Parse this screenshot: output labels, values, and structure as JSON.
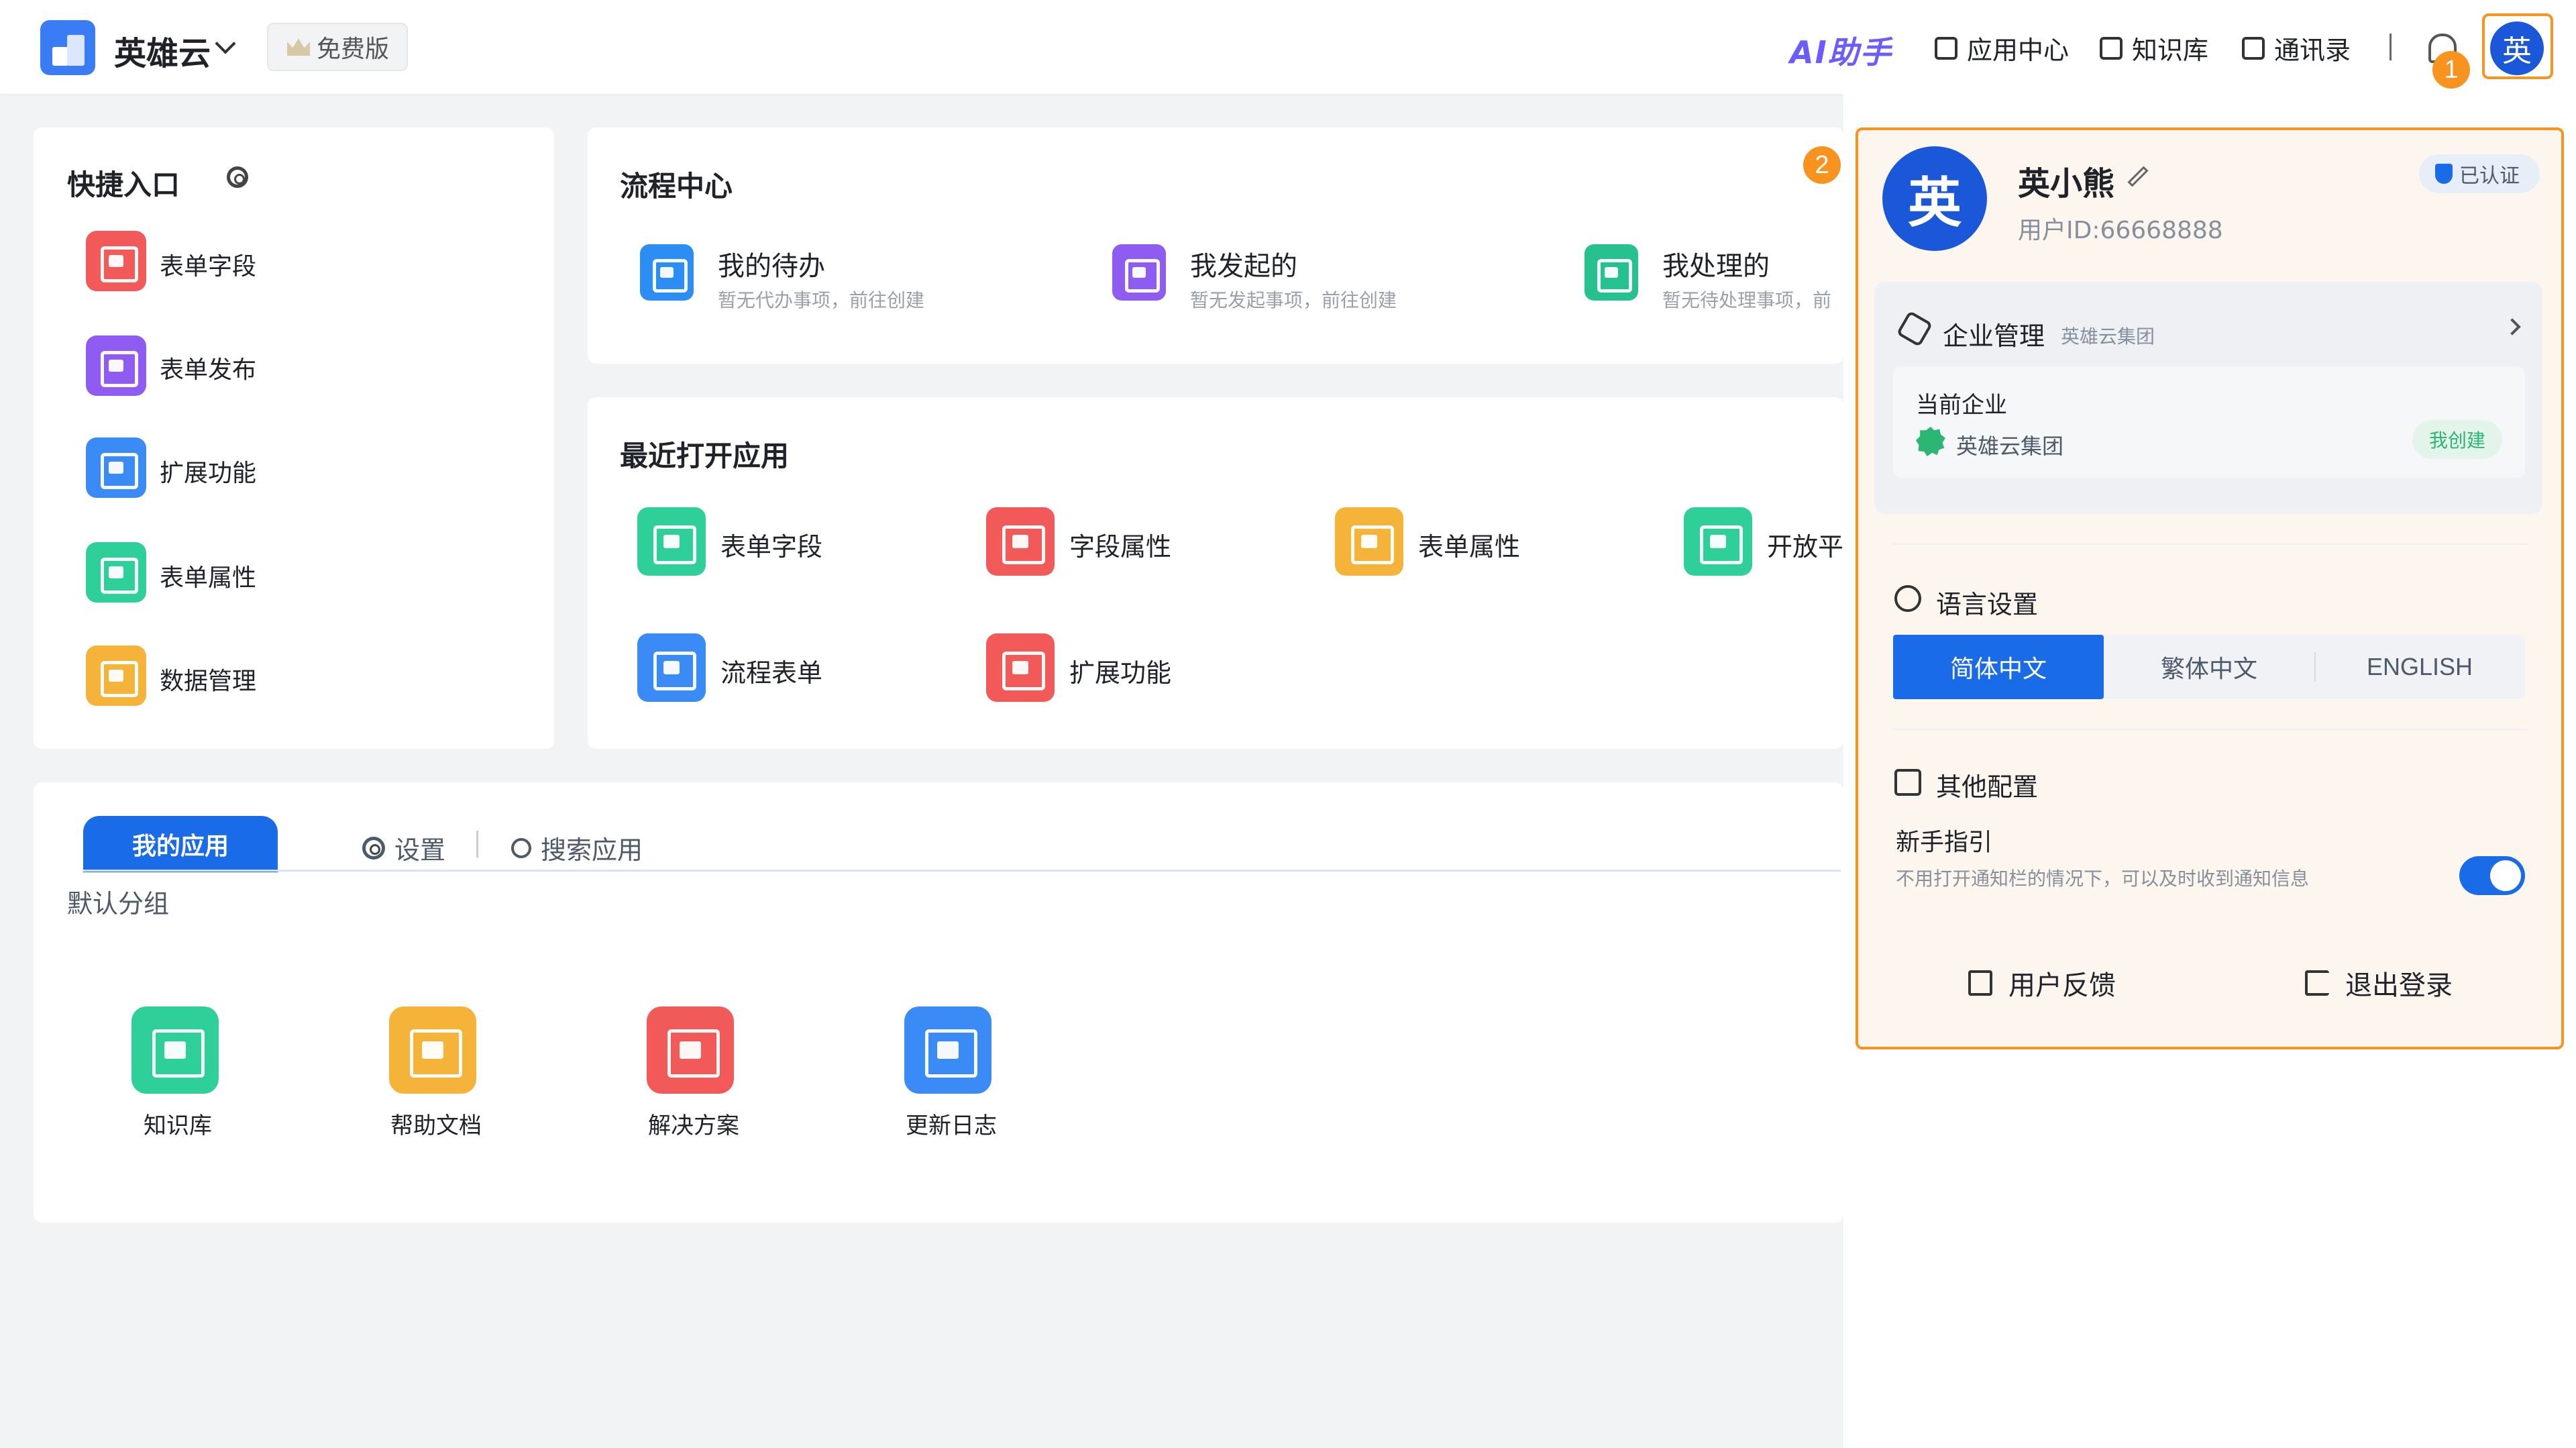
{
  "header": {
    "brand": "英雄云",
    "plan_badge": "免费版",
    "ai_assistant": "AI助手",
    "nav": [
      "应用中心",
      "知识库",
      "通讯录"
    ],
    "notification_step": "1",
    "avatar_char": "英"
  },
  "quick_entry": {
    "title": "快捷入口",
    "items": [
      {
        "label": "表单字段",
        "icon": "clipboard-chart-icon",
        "color": "#f25a5a"
      },
      {
        "label": "表单发布",
        "icon": "publish-window-icon",
        "color": "#8e5cf0"
      },
      {
        "label": "扩展功能",
        "icon": "mail-extend-icon",
        "color": "#3a8bf5"
      },
      {
        "label": "表单属性",
        "icon": "list-table-icon",
        "color": "#2ecf99"
      },
      {
        "label": "数据管理",
        "icon": "data-chart-icon",
        "color": "#f5b33a"
      }
    ]
  },
  "process_center": {
    "title": "流程中心",
    "step": "2",
    "items": [
      {
        "title": "我的待办",
        "sub": "暂无代办事项，前往创建",
        "color": "#2c8df4"
      },
      {
        "title": "我发起的",
        "sub": "暂无发起事项，前往创建",
        "color": "#8e5cf0"
      },
      {
        "title": "我处理的",
        "sub": "暂无待处理事项，前",
        "color": "#27c18f"
      }
    ]
  },
  "recent_apps": {
    "title": "最近打开应用",
    "items": [
      {
        "label": "表单字段",
        "color": "#2ecf99"
      },
      {
        "label": "字段属性",
        "color": "#f25a5a"
      },
      {
        "label": "表单属性",
        "color": "#f5b33a"
      },
      {
        "label": "开放平",
        "color": "#2ecf99"
      },
      {
        "label": "流程表单",
        "color": "#3a8bf5"
      },
      {
        "label": "扩展功能",
        "color": "#f25a5a"
      }
    ]
  },
  "my_apps": {
    "tab_active": "我的应用",
    "tab_settings": "设置",
    "tab_search": "搜索应用",
    "group": "默认分组",
    "items": [
      {
        "label": "知识库",
        "color": "#2ecf99"
      },
      {
        "label": "帮助文档",
        "color": "#f5b33a"
      },
      {
        "label": "解决方案",
        "color": "#f25a5a"
      },
      {
        "label": "更新日志",
        "color": "#3a8bf5"
      }
    ]
  },
  "profile_panel": {
    "avatar_char": "英",
    "name": "英小熊",
    "user_id": "用户ID:66668888",
    "verified": "已认证",
    "enterprise": {
      "title": "企业管理",
      "name_sub": "英雄云集团",
      "current_label": "当前企业",
      "current_name": "英雄云集团",
      "tag": "我创建"
    },
    "language": {
      "title": "语言设置",
      "options": [
        "简体中文",
        "繁体中文",
        "ENGLISH"
      ],
      "selected": "简体中文"
    },
    "other": {
      "title": "其他配置",
      "guide_label": "新手指引",
      "guide_desc": "不用打开通知栏的情况下，可以及时收到通知信息",
      "guide_on": true
    },
    "actions": {
      "feedback": "用户反馈",
      "logout": "退出登录"
    }
  },
  "colors": {
    "accent": "#1a6be8",
    "highlight": "#f7931e"
  }
}
